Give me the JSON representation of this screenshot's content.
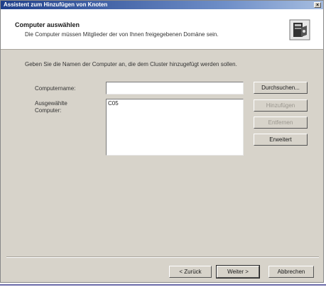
{
  "window": {
    "title": "Assistent zum Hinzufügen von Knoten",
    "close_glyph": "×"
  },
  "header": {
    "title": "Computer auswählen",
    "subtitle": "Die Computer müssen Mitglieder der von Ihnen freigegebenen Domäne sein.",
    "icon": "wizard-computer-icon"
  },
  "main": {
    "instruction": "Geben Sie die Namen der Computer an, die dem Cluster hinzugefügt werden sollen.",
    "computer_name": {
      "label": "Computername:",
      "value": ""
    },
    "selected": {
      "label_line1": "Ausgewählte",
      "label_line2": "Computer:",
      "items": [
        "C05"
      ]
    },
    "buttons": {
      "browse": "Durchsuchen...",
      "add": "Hinzufügen",
      "remove": "Entfernen",
      "advanced": "Erweitert"
    }
  },
  "footer": {
    "back": "< Zurück",
    "next": "Weiter >",
    "cancel": "Abbrechen"
  }
}
